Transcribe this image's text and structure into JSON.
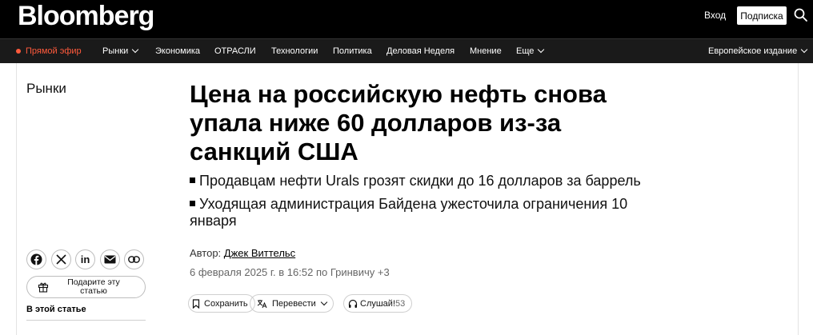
{
  "header": {
    "logo": "Bloomberg",
    "login_label": "Вход",
    "subscribe_label": "Подписка"
  },
  "nav": {
    "live_label": "Прямой эфир",
    "items": [
      "Рынки",
      "Экономика",
      "ОТРАСЛИ",
      "Технологии",
      "Политика",
      "Деловая Неделя",
      "Мнение",
      "Еще"
    ],
    "edition_label": "Европейское издание"
  },
  "section": "Рынки",
  "article": {
    "headline_lines": [
      "Цена на российскую нефть снова",
      "упала ниже 60 долларов из-за",
      "санкций США"
    ],
    "bullets": [
      "Продавцам нефти Urals грозят скидки до 16 долларов за баррель",
      "Уходящая администрация Байдена ужесточила ограничения 10 января"
    ],
    "author_prefix": "Автор:",
    "author_name": "Джек Виттельс",
    "date": "6 февраля 2025 г. в 16:52 по Гринвичу +3"
  },
  "actions": {
    "save_label": "Сохранить",
    "translate_label": "Перевести",
    "listen_label": "Слушай!",
    "listen_duration": "53"
  },
  "sidebar": {
    "gift_label": "Подарите эту статью",
    "in_article_label": "В этой статье"
  }
}
